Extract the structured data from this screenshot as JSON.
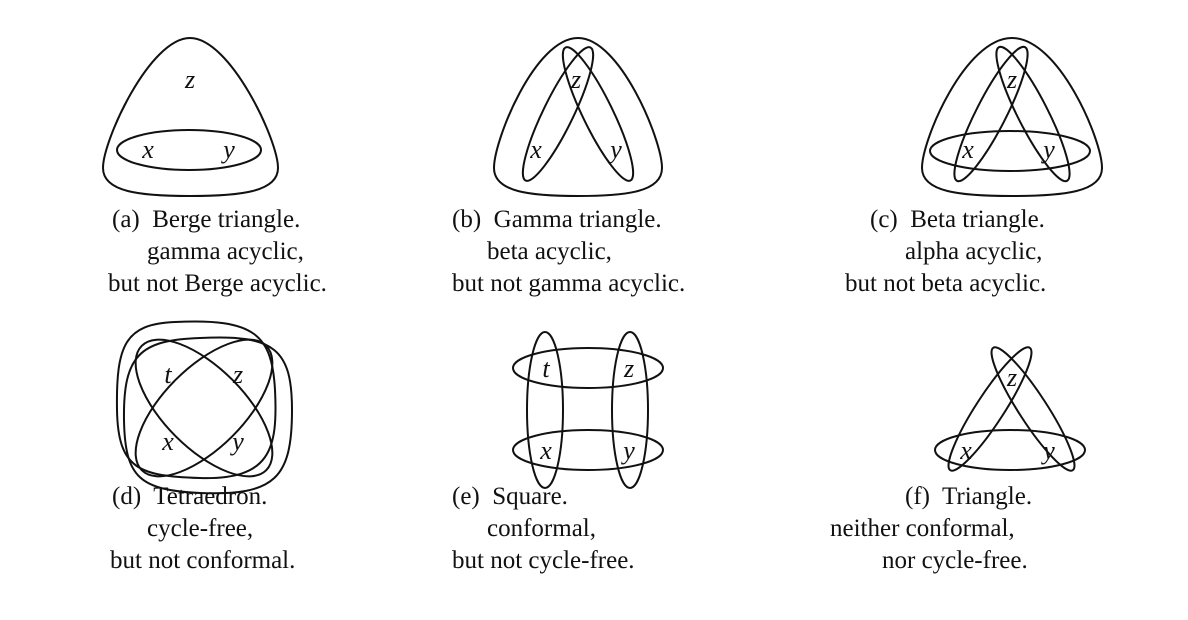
{
  "panels": [
    {
      "id": "a",
      "vertices": {
        "x": "x",
        "y": "y",
        "z": "z"
      },
      "caption": [
        "(a)  Berge triangle.",
        "gamma acyclic,",
        "but not Berge acyclic."
      ]
    },
    {
      "id": "b",
      "vertices": {
        "x": "x",
        "y": "y",
        "z": "z"
      },
      "caption": [
        "(b)  Gamma triangle.",
        "beta acyclic,",
        "but not gamma acyclic."
      ]
    },
    {
      "id": "c",
      "vertices": {
        "x": "x",
        "y": "y",
        "z": "z"
      },
      "caption": [
        "(c)  Beta triangle.",
        "alpha acyclic,",
        "but not beta acyclic."
      ]
    },
    {
      "id": "d",
      "vertices": {
        "t": "t",
        "x": "x",
        "y": "y",
        "z": "z"
      },
      "caption": [
        "(d)  Tetraedron.",
        "cycle-free,",
        "but not conformal."
      ]
    },
    {
      "id": "e",
      "vertices": {
        "t": "t",
        "x": "x",
        "y": "y",
        "z": "z"
      },
      "caption": [
        "(e)  Square.",
        "conformal,",
        "but not cycle-free."
      ]
    },
    {
      "id": "f",
      "vertices": {
        "x": "x",
        "y": "y",
        "z": "z"
      },
      "caption": [
        "(f)  Triangle.",
        "neither conformal,",
        "nor cycle-free."
      ]
    }
  ]
}
